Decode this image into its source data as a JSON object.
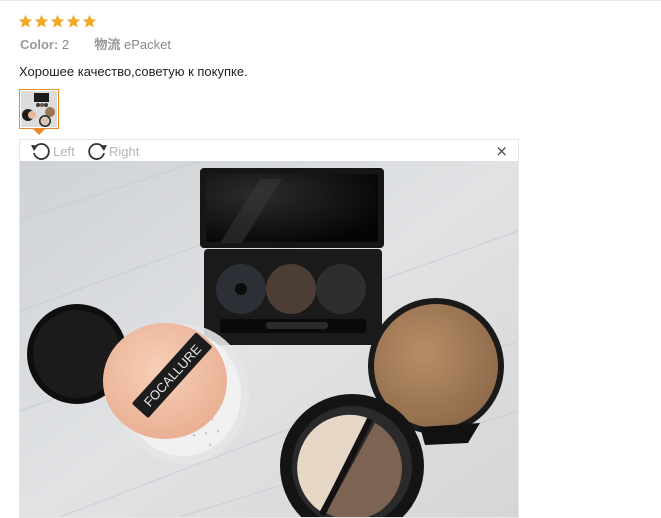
{
  "review": {
    "rating": 5,
    "max_rating": 5,
    "color_label": "Color:",
    "color_value": "2",
    "shipping_label": "物流",
    "shipping_value": "ePacket",
    "text": "Хорошее качество,советую к покупке."
  },
  "colors": {
    "star": "#f5a623",
    "thumb_border": "#e98a25"
  },
  "viewer": {
    "rotate_left_label": "Left",
    "rotate_right_label": "Right",
    "close_glyph": "×",
    "product_brand": "FOCALLURE"
  },
  "icons": {
    "rotate_left": "rotate-left-icon",
    "rotate_right": "rotate-right-icon",
    "close": "close-icon",
    "star": "star-icon"
  }
}
